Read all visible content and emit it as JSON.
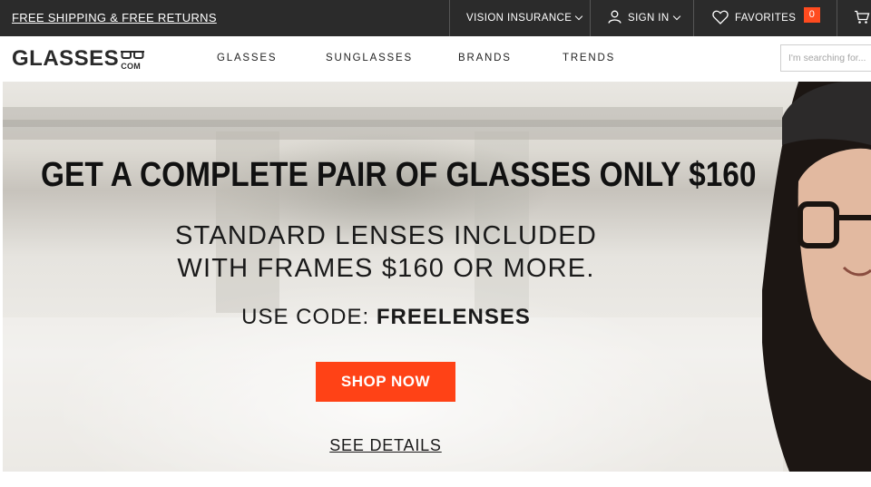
{
  "topbar": {
    "promo": "FREE SHIPPING & FREE RETURNS",
    "vision_insurance": "VISION INSURANCE",
    "sign_in": "SIGN IN",
    "favorites": "FAVORITES",
    "favorites_count": "0"
  },
  "header": {
    "logo_text": "GLASSES",
    "logo_suffix": "COM",
    "nav": [
      "GLASSES",
      "SUNGLASSES",
      "BRANDS",
      "TRENDS"
    ],
    "search_placeholder": "I'm searching for..."
  },
  "hero": {
    "headline": "GET A COMPLETE PAIR OF GLASSES ONLY $160",
    "subline_1": "STANDARD LENSES INCLUDED",
    "subline_2": "WITH FRAMES $160 OR MORE.",
    "code_label": "USE CODE:",
    "code_value": "FREELENSES",
    "cta": "SHOP NOW",
    "details_link": "SEE DETAILS"
  },
  "colors": {
    "topbar_bg": "#2b2b2b",
    "accent": "#ff4216",
    "text": "#111111"
  },
  "icons": [
    "user-icon",
    "heart-icon",
    "cart-icon",
    "chevron-down-icon",
    "glasses-logo-icon"
  ]
}
